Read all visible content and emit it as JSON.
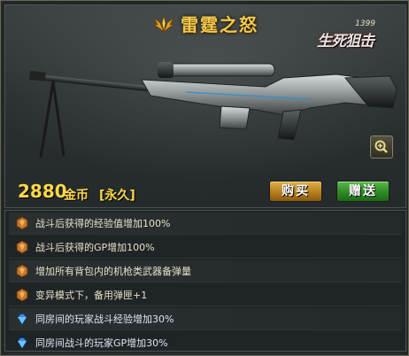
{
  "weapon": {
    "title": "雷霆之怒",
    "game_logo": {
      "number": "1399",
      "name": "生死狙击"
    },
    "price": "2880",
    "currency": "金币",
    "duration": "[永久]"
  },
  "buttons": {
    "buy": "购买",
    "gift": "赠送"
  },
  "attributes": [
    {
      "icon": "bronze-medal-icon",
      "text": "战斗后获得的经验值增加100%"
    },
    {
      "icon": "bronze-medal-icon",
      "text": "战斗后获得的GP增加100%"
    },
    {
      "icon": "bronze-medal-icon",
      "text": "增加所有背包内的机枪类武器备弹量"
    },
    {
      "icon": "bronze-medal-icon",
      "text": "变异模式下，备用弹匣+1"
    },
    {
      "icon": "blue-diamond-icon",
      "text": "同房间的玩家战斗经验增加30%"
    },
    {
      "icon": "blue-diamond-icon",
      "text": "同房间战斗的玩家GP增加30%"
    }
  ],
  "colors": {
    "gold": "#ffd84a",
    "title": "#f2c94c",
    "buy": "#b57f1d",
    "gift": "#2f8a25"
  }
}
